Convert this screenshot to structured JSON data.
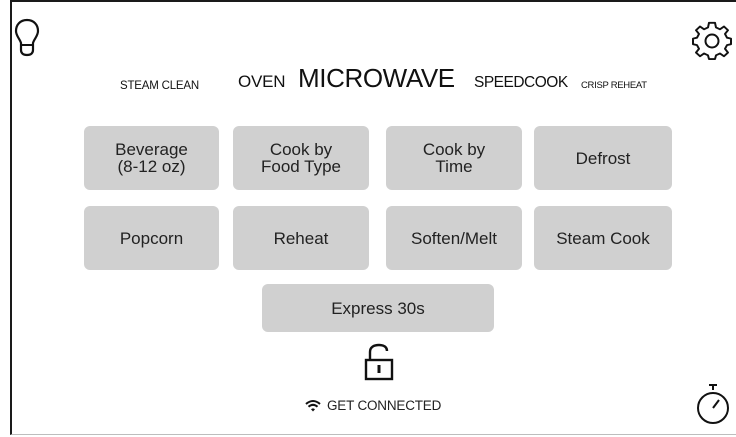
{
  "modes": {
    "steam_clean": "STEAM CLEAN",
    "oven": "OVEN",
    "microwave": "MICROWAVE",
    "speedcook": "SPEEDCOOK",
    "crisp_reheat": "CRISP REHEAT"
  },
  "buttons": [
    {
      "line1": "Beverage",
      "line2": "(8-12 oz)"
    },
    {
      "line1": "Cook by",
      "line2": "Food Type"
    },
    {
      "line1": "Cook by",
      "line2": "Time"
    },
    {
      "line1": "Defrost",
      "line2": ""
    },
    {
      "line1": "Popcorn",
      "line2": ""
    },
    {
      "line1": "Reheat",
      "line2": ""
    },
    {
      "line1": "Soften/Melt",
      "line2": ""
    },
    {
      "line1": "Steam Cook",
      "line2": ""
    }
  ],
  "express": "Express 30s",
  "connect": "GET CONNECTED",
  "icons": {
    "light": "lightbulb-icon",
    "settings": "gear-icon",
    "lock": "unlocked-lock-icon",
    "wifi": "wifi-icon",
    "timer": "timer-icon"
  }
}
